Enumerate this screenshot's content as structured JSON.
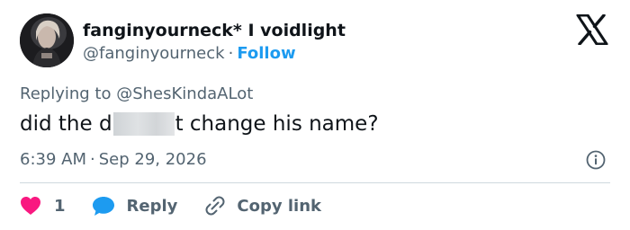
{
  "user": {
    "display_name": "fanginyourneck* I voidlight",
    "handle": "@fanginyourneck",
    "separator": "·",
    "follow_label": "Follow",
    "avatar": "avatar-photo"
  },
  "reply_context": {
    "prefix": "Replying to",
    "mention": "@ShesKindaALot"
  },
  "tweet": {
    "text_before": "did the d",
    "text_after": "t change his name?"
  },
  "meta": {
    "time": "6:39 AM",
    "separator": "·",
    "date": "Sep 29, 2026"
  },
  "actions": {
    "like_count": "1",
    "reply_label": "Reply",
    "copy_label": "Copy link"
  },
  "icons": {
    "logo": "x-logo-icon",
    "info": "info-icon",
    "like": "heart-icon",
    "reply": "speech-bubble-icon",
    "copy": "link-icon"
  },
  "colors": {
    "like": "#f91880",
    "reply": "#1d9bf0",
    "link": "#1d9bf0",
    "secondary_text": "#536471",
    "primary_text": "#0f1419",
    "divider": "#cfd9de"
  }
}
